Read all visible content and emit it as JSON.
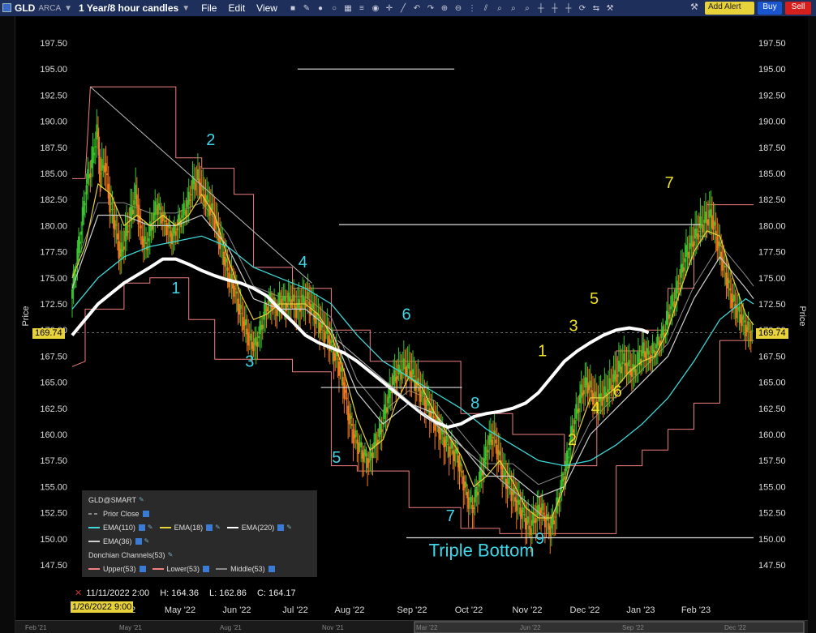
{
  "toolbar": {
    "symbol": "GLD",
    "exchange": "ARCA",
    "timeframe": "1 Year/8 hour candles",
    "menus": [
      "File",
      "Edit",
      "View"
    ],
    "alert_label": "Add Alert",
    "buy_label": "Buy",
    "sell_label": "Sell",
    "tool_icons": [
      "trend-line-icon",
      "undo-icon",
      "redo-icon",
      "zoom-in-icon",
      "zoom-out-icon",
      "crosshair-icon",
      "refresh-icon",
      "wrench-icon"
    ]
  },
  "legend": {
    "header": "GLD@SMART",
    "prior_close": "Prior Close",
    "ema110": "EMA(110)",
    "ema18": "EMA(18)",
    "ema220": "EMA(220)",
    "ema36": "EMA(36)",
    "donchian": "Donchian Channels(53)",
    "upper": "Upper(53)",
    "lower": "Lower(53)",
    "middle": "Middle(53)"
  },
  "ohlc": {
    "time": "11/11/2022 2:00",
    "high": "H: 164.36",
    "low": "L: 162.86",
    "close": "C: 164.17"
  },
  "cursor_date": "1/26/2022 9:00",
  "last_price": "169.74",
  "colors": {
    "background": "#000000",
    "up_candle": "#39c42e",
    "down_candle": "#f07a1c",
    "ema110": "#3fd7d7",
    "ema18": "#e8d23a",
    "ema220": "#ffffff",
    "ema36": "#cfcfcf",
    "donchian_upper": "#f08080",
    "donchian_lower": "#f08080",
    "donchian_middle": "#8a8a8a",
    "wave_cyan": "#3fd7e8",
    "wave_yellow": "#f0e020"
  },
  "chart_data": {
    "type": "line",
    "ylabel": "Price",
    "ylim": [
      145.5,
      199.0
    ],
    "yticks": [
      "197.50",
      "195.00",
      "192.50",
      "190.00",
      "187.50",
      "185.00",
      "182.50",
      "180.00",
      "177.50",
      "175.00",
      "172.50",
      "170.00",
      "167.50",
      "165.00",
      "162.50",
      "160.00",
      "157.50",
      "155.00",
      "152.50",
      "150.00",
      "147.50"
    ],
    "x_tick_labels": [
      "'22",
      "May '22",
      "Jun '22",
      "Jul '22",
      "Aug '22",
      "Sep '22",
      "Oct '22",
      "Nov '22",
      "Dec '22",
      "Jan '23",
      "Feb '23"
    ],
    "nav_labels": [
      "Feb '21",
      "May '21",
      "Aug '21",
      "Nov '21",
      "Mar '22",
      "Jun '22",
      "Sep '22",
      "Dec '22"
    ],
    "close_series": [
      [
        0,
        173
      ],
      [
        4,
        176.5
      ],
      [
        8,
        180
      ],
      [
        12,
        184
      ],
      [
        16,
        186
      ],
      [
        20,
        189
      ],
      [
        22,
        185
      ],
      [
        26,
        186
      ],
      [
        30,
        182
      ],
      [
        34,
        180
      ],
      [
        38,
        177
      ],
      [
        42,
        179
      ],
      [
        46,
        181
      ],
      [
        50,
        183
      ],
      [
        54,
        179
      ],
      [
        58,
        178
      ],
      [
        62,
        180
      ],
      [
        66,
        182
      ],
      [
        70,
        181
      ],
      [
        74,
        180
      ],
      [
        78,
        179
      ],
      [
        82,
        180
      ],
      [
        86,
        181
      ],
      [
        90,
        182
      ],
      [
        94,
        184
      ],
      [
        98,
        184.5
      ],
      [
        102,
        183
      ],
      [
        106,
        182
      ],
      [
        110,
        181
      ],
      [
        114,
        179
      ],
      [
        118,
        177
      ],
      [
        122,
        175
      ],
      [
        126,
        174
      ],
      [
        130,
        172
      ],
      [
        134,
        170.5
      ],
      [
        138,
        169
      ],
      [
        142,
        168.5
      ],
      [
        146,
        170
      ],
      [
        150,
        172
      ],
      [
        154,
        173
      ],
      [
        158,
        172
      ],
      [
        162,
        173
      ],
      [
        166,
        172.5
      ],
      [
        170,
        173
      ],
      [
        174,
        172
      ],
      [
        178,
        172.5
      ],
      [
        182,
        173
      ],
      [
        186,
        172
      ],
      [
        190,
        171
      ],
      [
        194,
        170
      ],
      [
        198,
        169.5
      ],
      [
        202,
        168
      ],
      [
        206,
        167
      ],
      [
        210,
        165
      ],
      [
        214,
        162
      ],
      [
        218,
        160
      ],
      [
        222,
        159
      ],
      [
        226,
        158
      ],
      [
        230,
        157.5
      ],
      [
        234,
        159
      ],
      [
        238,
        160
      ],
      [
        242,
        162
      ],
      [
        246,
        164
      ],
      [
        250,
        165.5
      ],
      [
        254,
        166
      ],
      [
        258,
        166.5
      ],
      [
        262,
        166
      ],
      [
        266,
        165
      ],
      [
        270,
        164
      ],
      [
        274,
        163
      ],
      [
        278,
        162
      ],
      [
        282,
        161
      ],
      [
        286,
        160
      ],
      [
        290,
        159
      ],
      [
        294,
        158.5
      ],
      [
        298,
        158
      ],
      [
        302,
        156
      ],
      [
        306,
        154
      ],
      [
        310,
        153
      ],
      [
        314,
        155
      ],
      [
        318,
        157
      ],
      [
        322,
        159
      ],
      [
        326,
        160
      ],
      [
        330,
        158
      ],
      [
        334,
        156
      ],
      [
        338,
        155
      ],
      [
        342,
        154
      ],
      [
        346,
        153
      ],
      [
        350,
        152
      ],
      [
        354,
        151
      ],
      [
        358,
        152
      ],
      [
        362,
        153
      ],
      [
        366,
        152
      ],
      [
        370,
        151
      ],
      [
        374,
        152.5
      ],
      [
        378,
        155
      ],
      [
        382,
        157
      ],
      [
        386,
        160
      ],
      [
        390,
        162
      ],
      [
        394,
        164
      ],
      [
        398,
        165
      ],
      [
        402,
        164
      ],
      [
        406,
        163
      ],
      [
        410,
        163.5
      ],
      [
        414,
        164
      ],
      [
        418,
        165
      ],
      [
        422,
        166
      ],
      [
        426,
        167
      ],
      [
        430,
        166.5
      ],
      [
        434,
        166
      ],
      [
        438,
        167
      ],
      [
        442,
        168
      ],
      [
        446,
        167.5
      ],
      [
        450,
        168
      ],
      [
        454,
        169
      ],
      [
        458,
        170
      ],
      [
        462,
        172
      ],
      [
        466,
        173
      ],
      [
        470,
        175
      ],
      [
        474,
        177
      ],
      [
        478,
        178
      ],
      [
        482,
        179
      ],
      [
        486,
        180
      ],
      [
        490,
        180.5
      ],
      [
        494,
        181
      ],
      [
        498,
        179
      ],
      [
        502,
        177
      ],
      [
        506,
        175
      ],
      [
        510,
        173
      ],
      [
        514,
        172
      ],
      [
        518,
        171
      ],
      [
        522,
        170
      ],
      [
        526,
        169.74
      ]
    ],
    "ema18": [
      [
        0,
        175
      ],
      [
        10,
        178
      ],
      [
        20,
        184
      ],
      [
        30,
        183
      ],
      [
        40,
        180
      ],
      [
        50,
        181
      ],
      [
        60,
        180
      ],
      [
        70,
        181
      ],
      [
        80,
        180
      ],
      [
        90,
        181
      ],
      [
        100,
        183
      ],
      [
        110,
        181
      ],
      [
        120,
        177
      ],
      [
        130,
        173.5
      ],
      [
        140,
        171
      ],
      [
        150,
        171.5
      ],
      [
        160,
        172.5
      ],
      [
        170,
        172.5
      ],
      [
        180,
        172.5
      ],
      [
        190,
        171.5
      ],
      [
        200,
        169.5
      ],
      [
        210,
        166
      ],
      [
        220,
        161.5
      ],
      [
        230,
        158.5
      ],
      [
        240,
        159.5
      ],
      [
        250,
        163
      ],
      [
        260,
        165.5
      ],
      [
        270,
        164.5
      ],
      [
        280,
        162
      ],
      [
        290,
        160
      ],
      [
        300,
        158
      ],
      [
        310,
        155
      ],
      [
        320,
        156
      ],
      [
        330,
        157.5
      ],
      [
        340,
        155.5
      ],
      [
        350,
        153
      ],
      [
        360,
        152
      ],
      [
        370,
        152
      ],
      [
        380,
        155
      ],
      [
        390,
        160
      ],
      [
        400,
        163.5
      ],
      [
        410,
        163.5
      ],
      [
        420,
        164.5
      ],
      [
        430,
        166
      ],
      [
        440,
        167
      ],
      [
        450,
        167.5
      ],
      [
        460,
        170
      ],
      [
        470,
        174
      ],
      [
        480,
        177.5
      ],
      [
        490,
        179.5
      ],
      [
        500,
        179
      ],
      [
        510,
        175
      ],
      [
        520,
        171.5
      ],
      [
        526,
        170.5
      ]
    ],
    "ema36": [
      [
        0,
        174
      ],
      [
        20,
        181
      ],
      [
        40,
        181
      ],
      [
        60,
        180
      ],
      [
        80,
        180
      ],
      [
        100,
        181
      ],
      [
        120,
        178
      ],
      [
        140,
        173
      ],
      [
        160,
        172
      ],
      [
        180,
        172
      ],
      [
        200,
        170
      ],
      [
        220,
        164
      ],
      [
        240,
        161
      ],
      [
        260,
        163
      ],
      [
        280,
        162
      ],
      [
        300,
        159
      ],
      [
        320,
        156
      ],
      [
        340,
        156
      ],
      [
        360,
        154
      ],
      [
        380,
        155
      ],
      [
        400,
        160
      ],
      [
        420,
        162.5
      ],
      [
        440,
        165
      ],
      [
        460,
        167.5
      ],
      [
        480,
        173
      ],
      [
        500,
        177
      ],
      [
        520,
        174
      ],
      [
        526,
        173
      ]
    ],
    "ema110": [
      [
        0,
        172
      ],
      [
        20,
        175
      ],
      [
        40,
        177
      ],
      [
        60,
        178
      ],
      [
        80,
        178.5
      ],
      [
        100,
        179
      ],
      [
        120,
        178
      ],
      [
        140,
        176
      ],
      [
        160,
        175
      ],
      [
        180,
        174
      ],
      [
        200,
        172.5
      ],
      [
        220,
        169.5
      ],
      [
        240,
        167
      ],
      [
        260,
        165.5
      ],
      [
        280,
        164
      ],
      [
        300,
        162.5
      ],
      [
        320,
        160.5
      ],
      [
        340,
        159
      ],
      [
        360,
        157.5
      ],
      [
        380,
        157
      ],
      [
        400,
        157.5
      ],
      [
        420,
        159
      ],
      [
        440,
        161
      ],
      [
        460,
        163.5
      ],
      [
        480,
        167
      ],
      [
        500,
        171
      ],
      [
        520,
        173
      ],
      [
        526,
        172.5
      ]
    ],
    "ema220": [
      [
        0,
        169.5
      ],
      [
        20,
        172.5
      ],
      [
        40,
        174.5
      ],
      [
        60,
        176
      ],
      [
        70,
        176.8
      ],
      [
        80,
        176.8
      ],
      [
        90,
        176.3
      ],
      [
        100,
        175.7
      ],
      [
        110,
        175.2
      ],
      [
        120,
        174.8
      ],
      [
        130,
        174.5
      ],
      [
        140,
        174
      ],
      [
        150,
        173.3
      ],
      [
        160,
        172
      ],
      [
        170,
        170.8
      ],
      [
        180,
        169.5
      ],
      [
        190,
        168.8
      ],
      [
        200,
        168.3
      ],
      [
        210,
        167.8
      ],
      [
        220,
        167
      ],
      [
        230,
        166
      ],
      [
        240,
        165
      ],
      [
        250,
        164
      ],
      [
        260,
        163
      ],
      [
        270,
        162
      ],
      [
        280,
        161.2
      ],
      [
        290,
        160.7
      ],
      [
        300,
        161
      ],
      [
        310,
        161.7
      ],
      [
        320,
        162
      ],
      [
        330,
        162.2
      ],
      [
        340,
        162.5
      ],
      [
        350,
        163
      ],
      [
        360,
        164
      ],
      [
        370,
        165.5
      ],
      [
        380,
        167
      ],
      [
        390,
        168
      ],
      [
        400,
        168.8
      ],
      [
        410,
        169.5
      ],
      [
        420,
        170
      ],
      [
        430,
        170.2
      ],
      [
        440,
        170
      ],
      [
        445,
        169.74
      ]
    ],
    "donchian_upper": [
      [
        0,
        184.5
      ],
      [
        10,
        184.5
      ],
      [
        14,
        193.3
      ],
      [
        80,
        193.3
      ],
      [
        80,
        186.5
      ],
      [
        100,
        186.5
      ],
      [
        100,
        185.5
      ],
      [
        125,
        185.5
      ],
      [
        125,
        183
      ],
      [
        140,
        183
      ],
      [
        140,
        176
      ],
      [
        170,
        176
      ],
      [
        170,
        174
      ],
      [
        200,
        174
      ],
      [
        200,
        170
      ],
      [
        230,
        170
      ],
      [
        230,
        167
      ],
      [
        260,
        167
      ],
      [
        260,
        167
      ],
      [
        300,
        167
      ],
      [
        300,
        162
      ],
      [
        340,
        162
      ],
      [
        340,
        160
      ],
      [
        380,
        160
      ],
      [
        380,
        157
      ],
      [
        405,
        157
      ],
      [
        405,
        163.5
      ],
      [
        420,
        163.5
      ],
      [
        420,
        168
      ],
      [
        440,
        168
      ],
      [
        440,
        170
      ],
      [
        460,
        170
      ],
      [
        460,
        174
      ],
      [
        480,
        174
      ],
      [
        480,
        179
      ],
      [
        490,
        179
      ],
      [
        490,
        182
      ],
      [
        526,
        182
      ]
    ],
    "donchian_lower": [
      [
        0,
        166.5
      ],
      [
        10,
        167
      ],
      [
        10,
        172
      ],
      [
        40,
        172
      ],
      [
        40,
        174.5
      ],
      [
        60,
        174.5
      ],
      [
        60,
        175
      ],
      [
        90,
        175
      ],
      [
        90,
        171
      ],
      [
        110,
        171
      ],
      [
        110,
        167.2
      ],
      [
        170,
        167.2
      ],
      [
        170,
        166
      ],
      [
        200,
        166
      ],
      [
        200,
        157
      ],
      [
        220,
        157
      ],
      [
        220,
        156.5
      ],
      [
        260,
        156.5
      ],
      [
        260,
        153
      ],
      [
        300,
        153
      ],
      [
        300,
        151
      ],
      [
        330,
        151
      ],
      [
        330,
        150.5
      ],
      [
        380,
        150.5
      ],
      [
        380,
        150.5
      ],
      [
        420,
        150.5
      ],
      [
        420,
        157
      ],
      [
        440,
        157
      ],
      [
        440,
        158.5
      ],
      [
        460,
        158.5
      ],
      [
        460,
        160.5
      ],
      [
        480,
        160.5
      ],
      [
        480,
        163
      ],
      [
        500,
        163
      ],
      [
        500,
        169
      ],
      [
        526,
        169
      ]
    ],
    "annotations": [
      {
        "label": "1",
        "color": "cyan",
        "x": 80,
        "y": 173.5
      },
      {
        "label": "2",
        "color": "cyan",
        "x": 107,
        "y": 187.7
      },
      {
        "label": "3",
        "color": "cyan",
        "x": 137,
        "y": 166.5
      },
      {
        "label": "4",
        "color": "cyan",
        "x": 178,
        "y": 176
      },
      {
        "label": "5",
        "color": "cyan",
        "x": 204,
        "y": 157.3
      },
      {
        "label": "6",
        "color": "cyan",
        "x": 258,
        "y": 171
      },
      {
        "label": "7",
        "color": "cyan",
        "x": 292,
        "y": 151.7
      },
      {
        "label": "8",
        "color": "cyan",
        "x": 311,
        "y": 162.5
      },
      {
        "label": "9",
        "color": "cyan",
        "x": 361,
        "y": 149.5
      },
      {
        "label": "Triple Bottom",
        "color": "cyan",
        "x": 316,
        "y": 148.3
      },
      {
        "label": "1",
        "color": "yellow",
        "x": 363,
        "y": 167.5
      },
      {
        "label": "2",
        "color": "yellow",
        "x": 386,
        "y": 159
      },
      {
        "label": "3",
        "color": "yellow",
        "x": 387,
        "y": 169.9
      },
      {
        "label": "4",
        "color": "yellow",
        "x": 404,
        "y": 162
      },
      {
        "label": "5",
        "color": "yellow",
        "x": 403,
        "y": 172.5
      },
      {
        "label": "6",
        "color": "yellow",
        "x": 421,
        "y": 163.6
      },
      {
        "label": "7",
        "color": "yellow",
        "x": 461,
        "y": 183.6
      }
    ],
    "horizontal_lines": [
      {
        "x1": 174,
        "x2": 295,
        "y": 195
      },
      {
        "x1": 206,
        "x2": 485,
        "y": 180.1
      },
      {
        "x1": 192,
        "x2": 301,
        "y": 164.5
      },
      {
        "x1": 258,
        "x2": 526,
        "y": 150.1
      }
    ],
    "trendlines": [
      {
        "x1": 14,
        "y1": 193.3,
        "x2": 185,
        "y2": 174.5
      },
      {
        "x1": 205,
        "y1": 169,
        "x2": 365,
        "y2": 152
      }
    ]
  }
}
